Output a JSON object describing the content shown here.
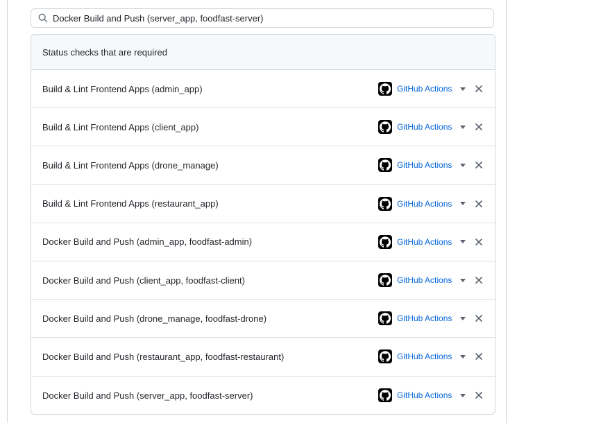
{
  "search": {
    "value": "Docker Build and Push (server_app, foodfast-server)",
    "icon": "search-icon"
  },
  "status_checks": {
    "header": "Status checks that are required",
    "items": [
      {
        "name": "Build & Lint Frontend Apps (admin_app)",
        "app": "GitHub Actions"
      },
      {
        "name": "Build & Lint Frontend Apps (client_app)",
        "app": "GitHub Actions"
      },
      {
        "name": "Build & Lint Frontend Apps (drone_manage)",
        "app": "GitHub Actions"
      },
      {
        "name": "Build & Lint Frontend Apps (restaurant_app)",
        "app": "GitHub Actions"
      },
      {
        "name": "Docker Build and Push (admin_app, foodfast-admin)",
        "app": "GitHub Actions"
      },
      {
        "name": "Docker Build and Push (client_app, foodfast-client)",
        "app": "GitHub Actions"
      },
      {
        "name": "Docker Build and Push (drone_manage, foodfast-drone)",
        "app": "GitHub Actions"
      },
      {
        "name": "Docker Build and Push (restaurant_app, foodfast-restaurant)",
        "app": "GitHub Actions"
      },
      {
        "name": "Docker Build and Push (server_app, foodfast-server)",
        "app": "GitHub Actions"
      }
    ]
  },
  "icons": {
    "app_logo": "github-logo-icon",
    "caret": "caret-down-icon",
    "remove": "close-icon"
  },
  "colors": {
    "link": "#0969da",
    "border": "#d0d7de",
    "header_bg": "#f6f8fa"
  }
}
